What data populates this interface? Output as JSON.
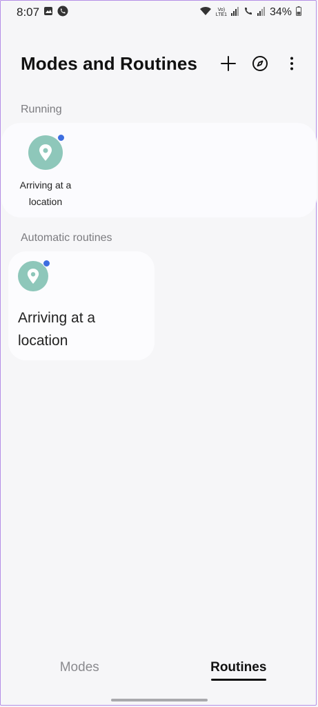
{
  "status_bar": {
    "time": "8:07",
    "battery": "34%",
    "network_label": "VoLTE1"
  },
  "header": {
    "title": "Modes and Routines"
  },
  "sections": {
    "running": {
      "label": "Running",
      "items": [
        {
          "label": "Arriving at a location",
          "icon": "location-pin-icon"
        }
      ]
    },
    "automatic": {
      "label": "Automatic routines",
      "items": [
        {
          "label": "Arriving at a location",
          "icon": "location-pin-icon"
        }
      ]
    }
  },
  "bottom_nav": {
    "tabs": [
      {
        "label": "Modes",
        "active": false
      },
      {
        "label": "Routines",
        "active": true
      }
    ]
  },
  "colors": {
    "accent_teal": "#8ec7ba",
    "indicator_blue": "#3d6ee0",
    "background": "#f6f6f8"
  }
}
